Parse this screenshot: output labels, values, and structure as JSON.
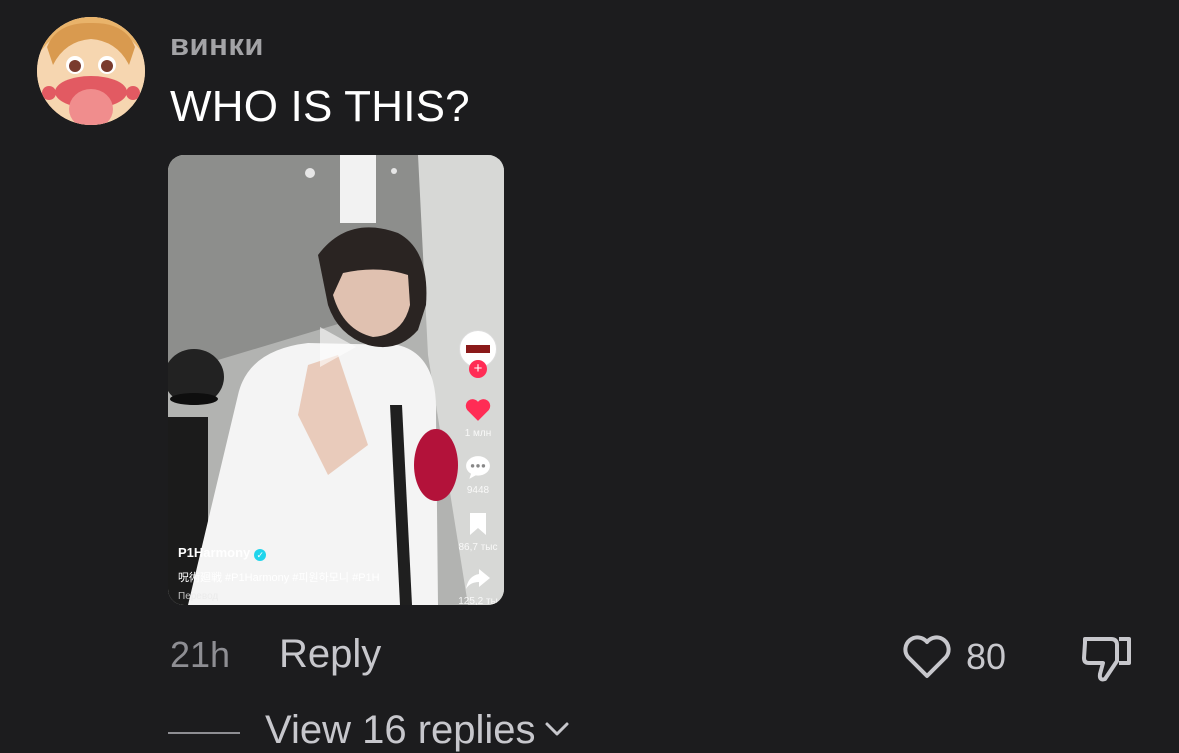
{
  "comment": {
    "username": "винки",
    "text": "WHO IS THIS?",
    "time": "21h",
    "reply_label": "Reply",
    "like_count": "80",
    "view_replies_label": "View 16 replies"
  },
  "video_preview": {
    "author": "P1Harmony",
    "caption": "呪術廻戦 #P1Harmony #피원하모니 #P1H",
    "translate_label": "Перевод",
    "likes": "1 млн",
    "comments": "9448",
    "saves": "86,7 тыс",
    "shares": "125,2 ты"
  },
  "icons": {
    "avatar": "anime-character-avatar",
    "play": "play-icon",
    "like": "heart-outline-icon",
    "dislike": "thumbs-down-icon",
    "chevron": "chevron-down-icon"
  },
  "colors": {
    "background": "#1c1c1e",
    "username": "#a3a3a6",
    "secondary_text": "#c7c7cc",
    "video_like": "#ff2c55"
  }
}
